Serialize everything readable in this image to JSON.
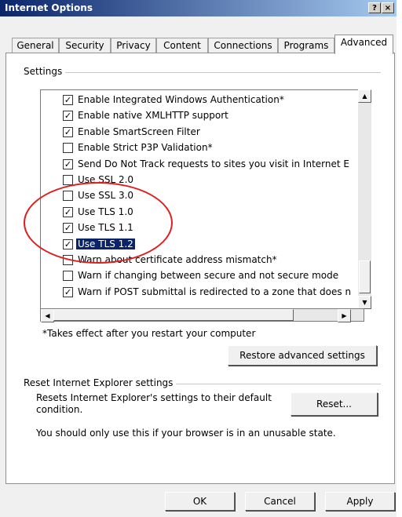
{
  "window": {
    "title": "Internet Options",
    "help_label": "?",
    "close_label": "×"
  },
  "tabs": [
    "General",
    "Security",
    "Privacy",
    "Content",
    "Connections",
    "Programs",
    "Advanced"
  ],
  "settings_group": {
    "label": "Settings",
    "rows": [
      {
        "label": "Enable Integrated Windows Authentication*",
        "checked": true,
        "selected": false
      },
      {
        "label": "Enable native XMLHTTP support",
        "checked": true,
        "selected": false
      },
      {
        "label": "Enable SmartScreen Filter",
        "checked": true,
        "selected": false
      },
      {
        "label": "Enable Strict P3P Validation*",
        "checked": false,
        "selected": false
      },
      {
        "label": "Send Do Not Track requests to sites you visit in Internet E",
        "checked": true,
        "selected": false
      },
      {
        "label": "Use SSL 2.0",
        "checked": false,
        "selected": false
      },
      {
        "label": "Use SSL 3.0",
        "checked": false,
        "selected": false
      },
      {
        "label": "Use TLS 1.0",
        "checked": true,
        "selected": false
      },
      {
        "label": "Use TLS 1.1",
        "checked": true,
        "selected": false
      },
      {
        "label": "Use TLS 1.2",
        "checked": true,
        "selected": true
      },
      {
        "label": "Warn about certificate address mismatch*",
        "checked": false,
        "selected": false
      },
      {
        "label": "Warn if changing between secure and not secure mode",
        "checked": false,
        "selected": false
      },
      {
        "label": "Warn if POST submittal is redirected to a zone that does n",
        "checked": true,
        "selected": false
      }
    ],
    "footnote": "*Takes effect after you restart your computer",
    "restore_button": "Restore advanced settings"
  },
  "reset_group": {
    "label": "Reset Internet Explorer settings",
    "description": "Resets Internet Explorer's settings to their default condition.",
    "reset_button": "Reset...",
    "note": "You should only use this if your browser is in an unusable state."
  },
  "buttons": {
    "ok": "OK",
    "cancel": "Cancel",
    "apply": "Apply"
  },
  "colors": {
    "annotation": "#dc2020",
    "selection": "#0a246a"
  }
}
